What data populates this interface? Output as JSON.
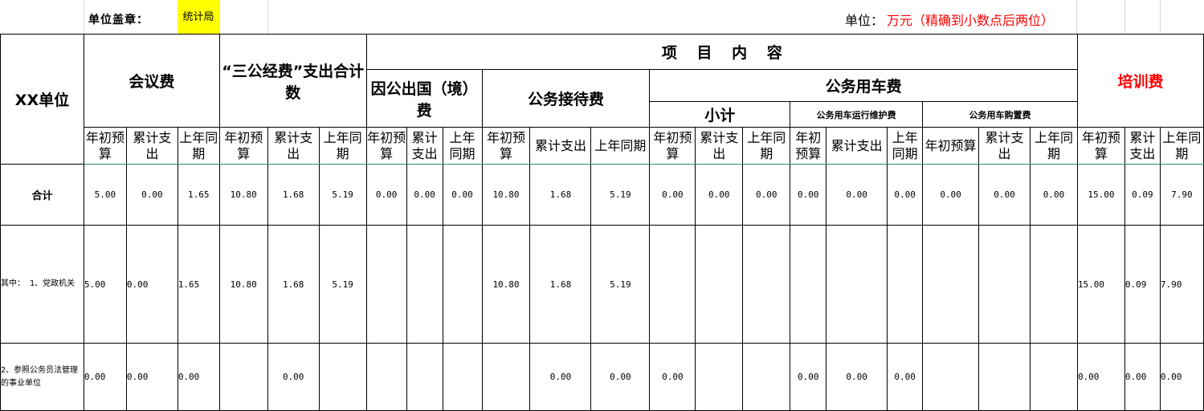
{
  "top": {
    "seal_label": "单位盖章：",
    "seal_value": "统计局",
    "unit_label": "单位：",
    "unit_value": "万元（精确到小数点后两位）"
  },
  "headers": {
    "unit_col": "XX单位",
    "meeting": "会议费",
    "sangong_total": "“三公经费”支出合计数",
    "project_content": "项 目 内 容",
    "abroad": "因公出国（境）费",
    "reception": "公务接待费",
    "car": "公务用车费",
    "subtotal": "小计",
    "car_run": "公务用车运行维护费",
    "car_buy": "公务用车购置费",
    "training": "培训费"
  },
  "subheaders": [
    "年初预算",
    "累计支出",
    "上年同期",
    "年初预算",
    "累计支出",
    "上年同期",
    "年初预算",
    "累计支出",
    "上年同期",
    "年初预算",
    "累计支出",
    "上年同期",
    "年初预算",
    "累计支出",
    "上年同期",
    "年初预算",
    "累计支出",
    "上年同期",
    "年初预算",
    "累计支出",
    "上年同期",
    "年初预算",
    "累计支出",
    "上年同期"
  ],
  "rows": [
    {
      "label": "合计",
      "values": [
        "5.00",
        "0.00",
        "1.65",
        "10.80",
        "1.68",
        "5.19",
        "0.00",
        "0.00",
        "0.00",
        "10.80",
        "1.68",
        "5.19",
        "0.00",
        "0.00",
        "0.00",
        "0.00",
        "0.00",
        "0.00",
        "0.00",
        "0.00",
        "0.00",
        "15.00",
        "0.09",
        "7.90"
      ]
    },
    {
      "label": "其中：    1、党政机关",
      "values": [
        "5.00",
        "0.00",
        "1.65",
        "10.80",
        "1.68",
        "5.19",
        "",
        "",
        "",
        "10.80",
        "1.68",
        "5.19",
        "",
        "",
        "",
        "",
        "",
        "",
        "",
        "",
        "",
        "15.00",
        "0.09",
        "7.90"
      ]
    },
    {
      "label": "2、参照公务员法管理的事业单位",
      "values": [
        "0.00",
        "0.00",
        "0.00",
        "",
        "0.00",
        "",
        "",
        "",
        "",
        "",
        "0.00",
        "0.00",
        "0.00",
        "",
        "",
        "0.00",
        "0.00",
        "0.00",
        "",
        "",
        "",
        "0.00",
        "0.00",
        "0.00"
      ]
    }
  ]
}
